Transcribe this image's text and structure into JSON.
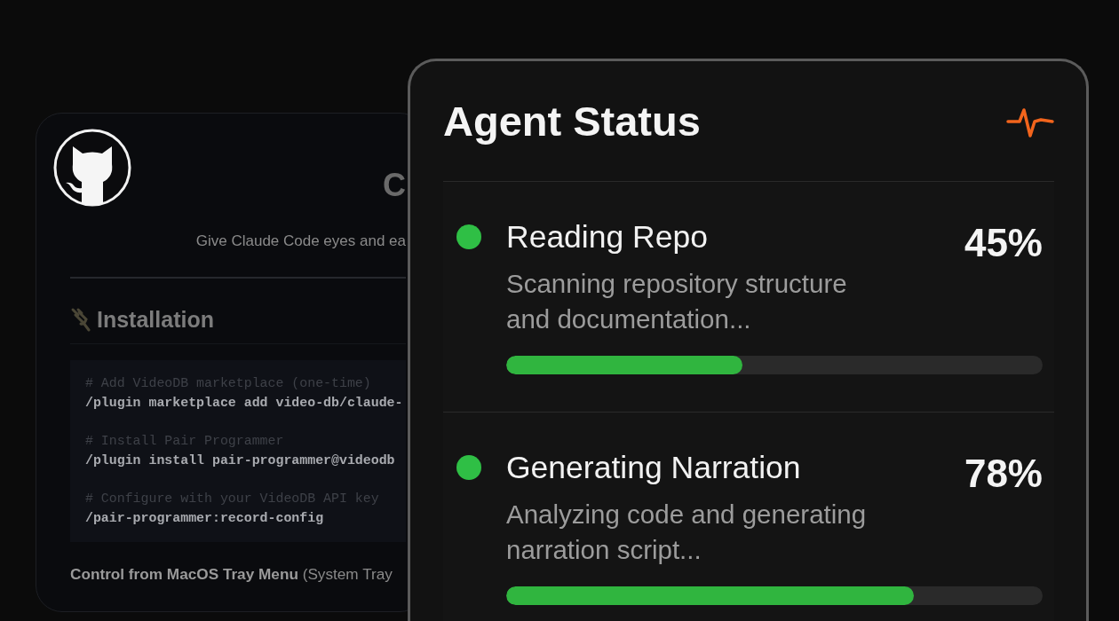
{
  "background_window": {
    "title": "C",
    "subtitle": "Give Claude Code eyes and ea",
    "section_heading": "Installation",
    "code_groups": [
      {
        "comment": "# Add VideoDB marketplace (one-time)",
        "command": "/plugin marketplace add video-db/claude-"
      },
      {
        "comment": "# Install Pair Programmer",
        "command": "/plugin install pair-programmer@videodb"
      },
      {
        "comment": "# Configure with your VideoDB API key",
        "command": "/pair-programmer:record-config"
      }
    ],
    "footer_text": "**Control from MacOS Tray Menu** (System Tray"
  },
  "status_panel": {
    "title": "Agent Status",
    "tasks": [
      {
        "name": "Reading Repo",
        "percent": "45%",
        "description": "Scanning repository structure and documentation...",
        "level": 0.44
      },
      {
        "name": "Generating Narration",
        "percent": "78%",
        "description": "Analyzing code and generating narration script...",
        "level": 0.76
      }
    ]
  }
}
